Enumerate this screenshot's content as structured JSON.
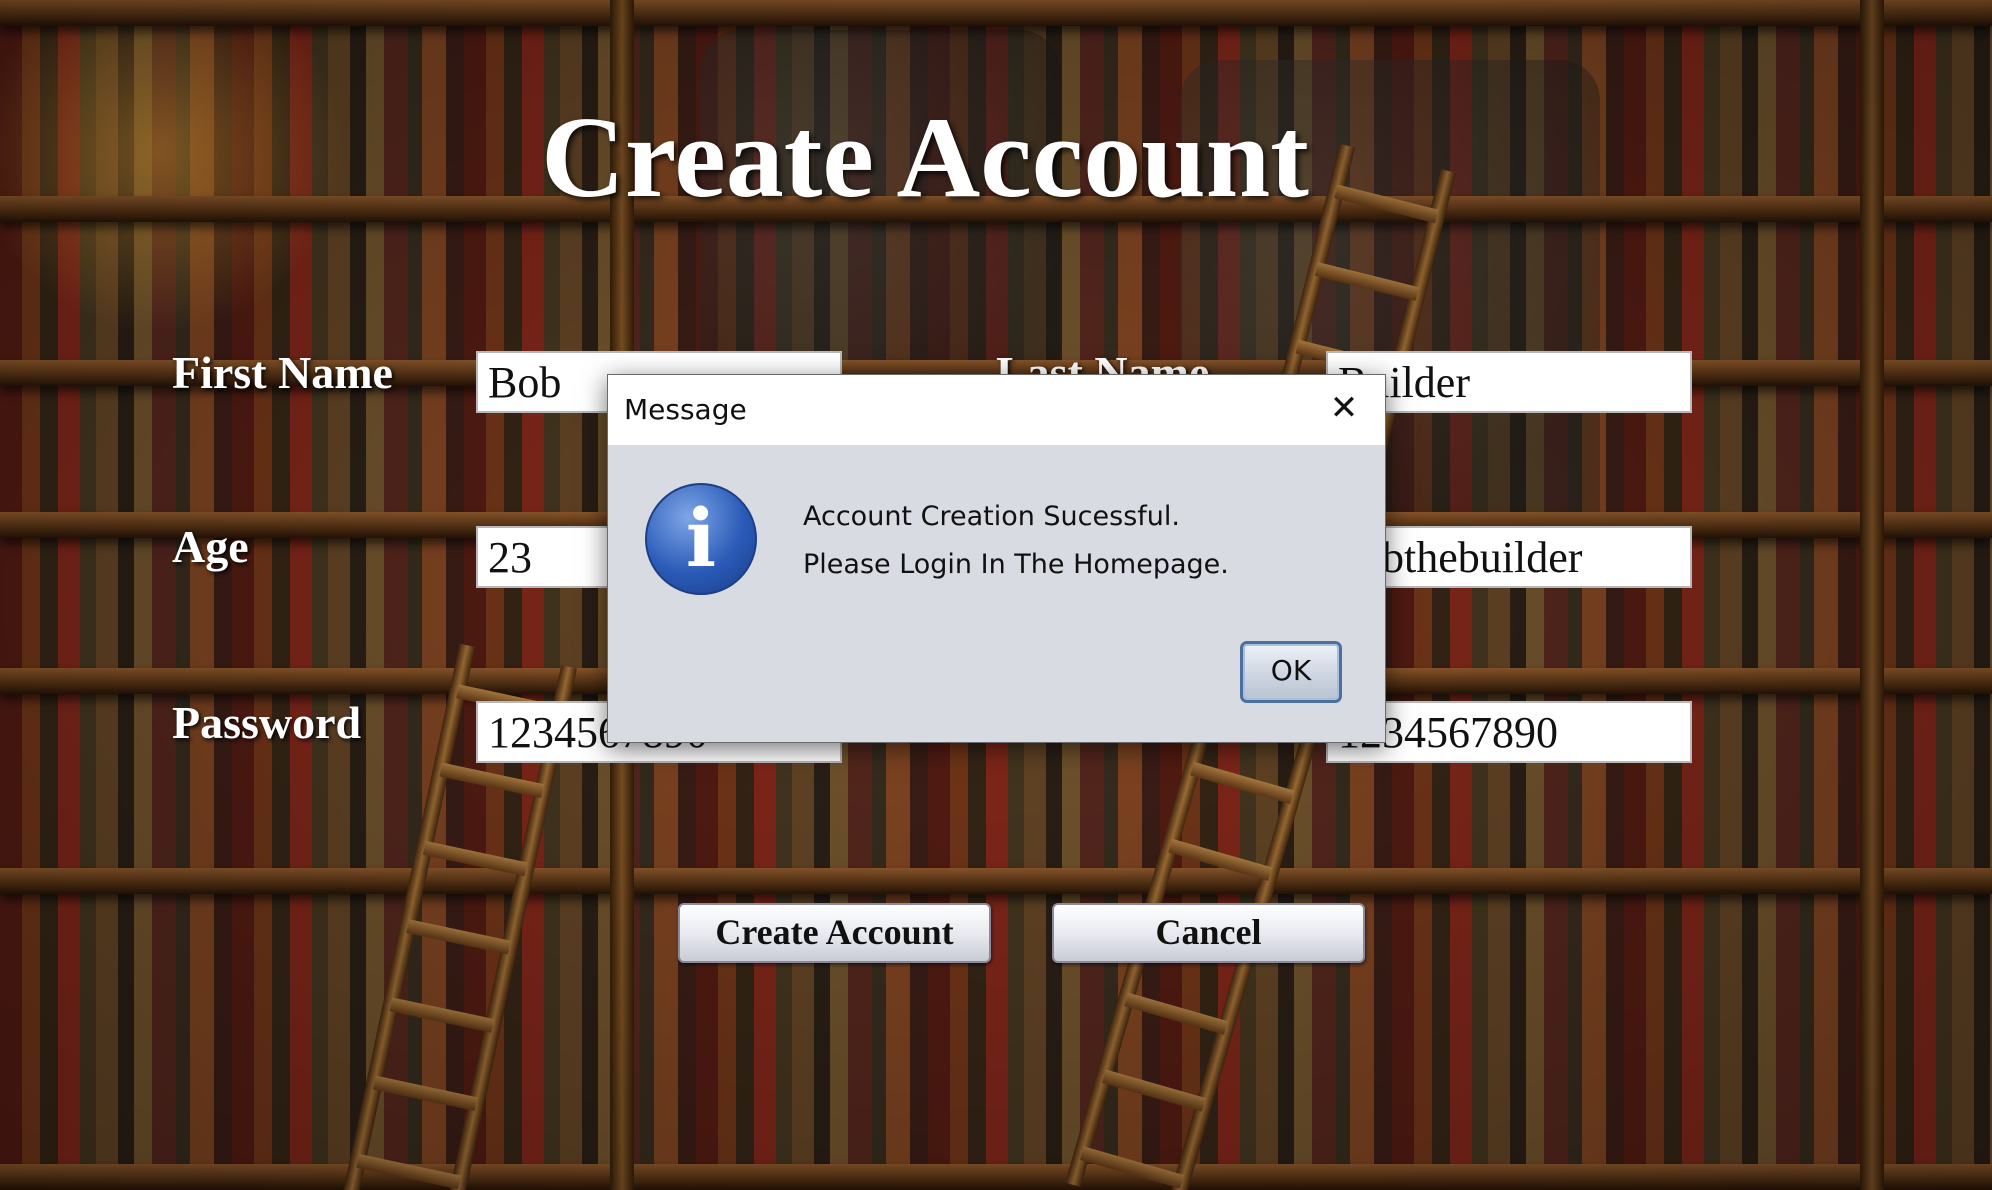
{
  "form": {
    "title": "Create Account",
    "fields": {
      "first_name": {
        "label": "First Name",
        "value": "Bob"
      },
      "last_name": {
        "label": "Last Name",
        "value": "Builder"
      },
      "age": {
        "label": "Age",
        "value": "23"
      },
      "username": {
        "value": "bobthebuilder"
      },
      "password": {
        "label": "Password",
        "value": "1234567890"
      },
      "confirm_password": {
        "value": "1234567890"
      }
    },
    "buttons": {
      "create": "Create Account",
      "cancel": "Cancel"
    }
  },
  "dialog": {
    "title": "Message",
    "close_glyph": "✕",
    "icon": "information-icon",
    "icon_glyph": "i",
    "line1": "Account Creation Sucessful.",
    "line2": "Please Login In The Homepage.",
    "ok_label": "OK"
  }
}
